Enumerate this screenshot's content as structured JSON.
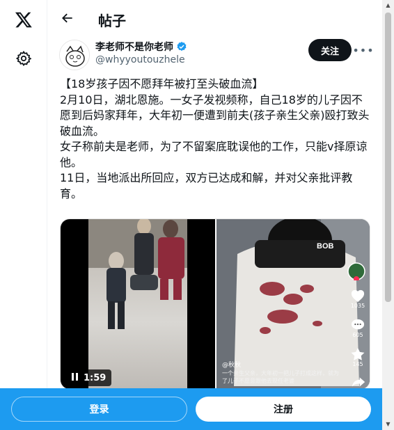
{
  "header": {
    "title": "帖子"
  },
  "author": {
    "name": "李老师不是你老师",
    "handle": "@whyyoutouzhele",
    "follow_label": "关注",
    "more_label": "•••"
  },
  "post": {
    "paragraphs": [
      "【18岁孩子因不愿拜年被打至头破血流】",
      "2月10日，湖北恩施。一女子发视频称，自己18岁的儿子因不愿到后妈家拜年，大年初一便遭到前夫(孩子亲生父亲)殴打致头破血流。",
      "女子称前夫是老师，为了不留案底耽误他的工作，只能v择原谅他。",
      "11日，当地派出所回应，双方已达成和解，并对父亲批评教育。"
    ]
  },
  "media": {
    "video_time": "1:59",
    "right_caption_user": "@秋秋",
    "right_caption_text": "一个亲生父亲，大年初一把儿子打成这样，就为了儿子不愿意跟他去现任老婆",
    "jacket_text": "BOB",
    "side_counts": {
      "likes": "1035",
      "comments": "605",
      "favorites": "145"
    }
  },
  "bottom": {
    "login_label": "登录",
    "signup_label": "注册"
  },
  "colors": {
    "brand": "#1d9bf0",
    "text": "#0f1419",
    "muted": "#536471"
  }
}
